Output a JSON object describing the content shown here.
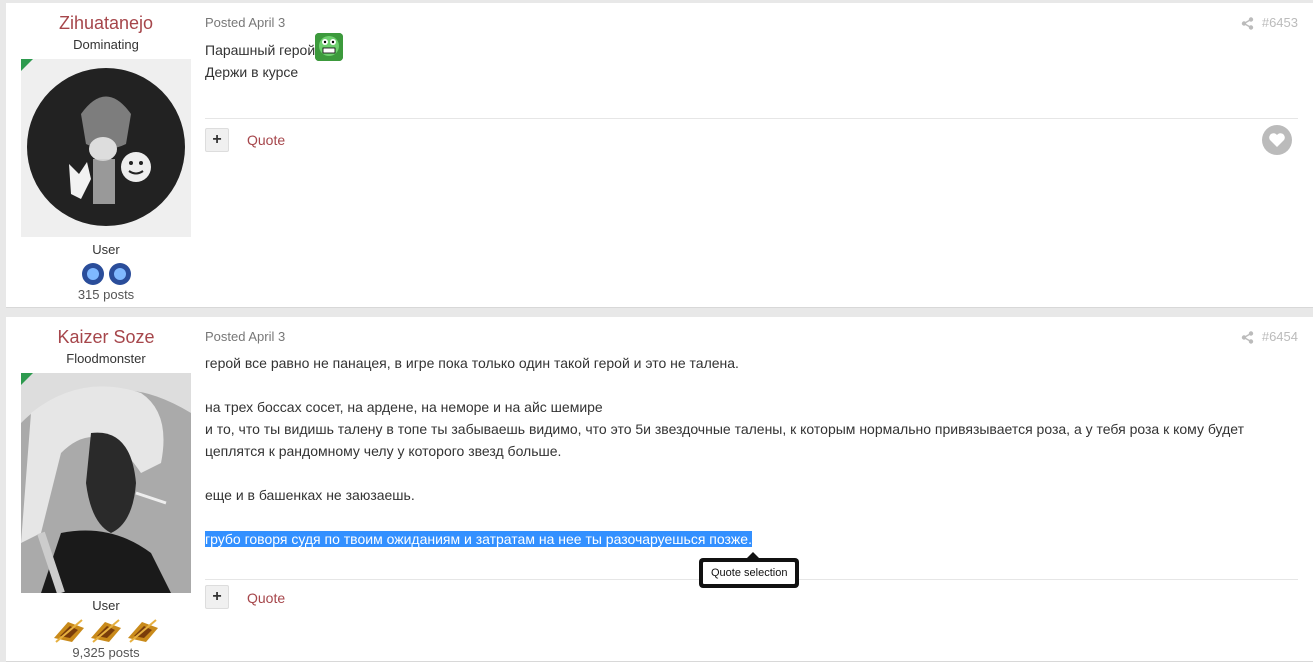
{
  "posts": [
    {
      "author": "Zihuatanejo",
      "rank": "Dominating",
      "group": "User",
      "post_count": "315 posts",
      "posted": "Posted April 3",
      "number": "#6453",
      "lines": [
        "Парашный герой",
        "Держи в курсе"
      ],
      "quote_label": "Quote"
    },
    {
      "author": "Kaizer Soze",
      "rank": "Floodmonster",
      "group": "User",
      "post_count": "9,325 posts",
      "posted": "Posted April 3",
      "number": "#6454",
      "lines": [
        "герой все равно не панацея, в игре пока только один такой герой и это не талена.",
        "на трех боссах сосет, на ардене, на неморе и на айс шемире",
        "и то, что ты видишь талену в топе ты забываешь видимо, что это 5и звездочные талены, к которым нормально привязывается роза, а у тебя роза к кому будет",
        "цеплятся к рандомному челу у которого звезд больше.",
        "еще и в башенках не заюзаешь.",
        "грубо говоря судя по твоим ожиданиям и затратам на нее ты разочаруешься позже."
      ],
      "quote_label": "Quote"
    }
  ],
  "tooltip": {
    "label": "Quote selection"
  },
  "colors": {
    "author": "#a6464b",
    "selection": "#3390ff",
    "online_corner": "#2d9a4e"
  },
  "icons": [
    "share-icon",
    "plus-icon",
    "heart-icon",
    "emoji-icon",
    "badge-icon"
  ]
}
